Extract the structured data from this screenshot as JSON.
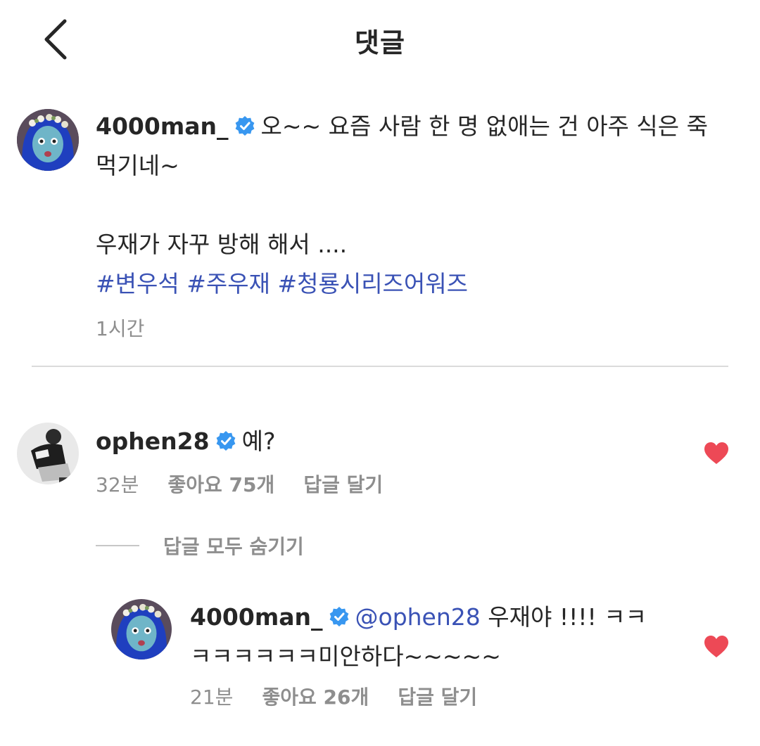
{
  "header": {
    "title": "댓글",
    "back_icon": "chevron-left-icon"
  },
  "caption": {
    "username": "4000man_",
    "verified_icon": "verified-badge-icon",
    "text_line1": "오~~ 요즘 사람 한 명 없애는 건 아주 식은 죽",
    "text_line2": "먹기네~",
    "text_line3": "우재가 자꾸 방해 해서 ....",
    "hashtags": [
      "#변우석",
      "#주우재",
      "#청룡시리즈어워즈"
    ],
    "time": "1시간"
  },
  "comments": [
    {
      "username": "ophen28",
      "text": "예?",
      "time": "32분",
      "likes": "좋아요 75개",
      "reply_label": "답글 달기",
      "liked": true
    }
  ],
  "hide_replies_label": "답글 모두 숨기기",
  "replies": [
    {
      "username": "4000man_",
      "mention": "@ophen28",
      "text_line1": "우재야 !!!! ㅋㅋ",
      "text_line2": "ㅋㅋㅋㅋㅋㅋ미안하다~~~~~",
      "time": "21분",
      "likes": "좋아요 26개",
      "reply_label": "답글 달기",
      "liked": true
    }
  ],
  "colors": {
    "text": "#262626",
    "secondary": "#8e8e8e",
    "link": "#3a52b5",
    "verified": "#3897f0",
    "heart": "#ed4956",
    "divider": "#dbdbdb"
  }
}
